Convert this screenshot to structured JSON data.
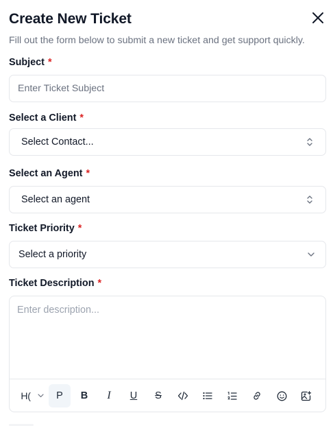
{
  "modal": {
    "title": "Create New Ticket",
    "subtitle": "Fill out the form below to submit a new ticket and get support quickly."
  },
  "form": {
    "subject": {
      "label": "Subject",
      "required": "*",
      "placeholder": "Enter Ticket Subject",
      "value": ""
    },
    "client": {
      "label": "Select a Client",
      "required": "*",
      "selected": "Select Contact..."
    },
    "agent": {
      "label": "Select an Agent",
      "required": "*",
      "selected": "Select an agent"
    },
    "priority": {
      "label": "Ticket Priority",
      "required": "*",
      "selected": "Select a priority"
    },
    "description": {
      "label": "Ticket Description",
      "required": "*",
      "placeholder": "Enter description...",
      "toolbar": {
        "heading": "H(",
        "paragraph": "P",
        "bold": "B",
        "italic": "I",
        "underline": "U",
        "strikethrough": "S"
      }
    }
  },
  "colors": {
    "required": "#dc2626",
    "border": "#e5e7eb",
    "muted": "#6b7280",
    "active_tool_bg": "#f1f5f9"
  }
}
